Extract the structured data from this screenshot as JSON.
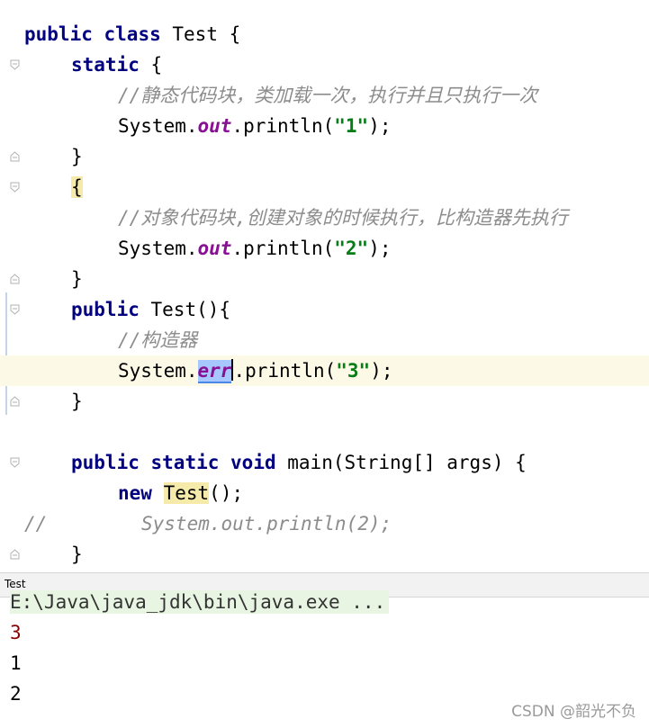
{
  "editor": {
    "lines": {
      "l1": {
        "kw1": "public",
        "kw2": "class",
        "name": "Test",
        "brace": "{"
      },
      "l2": {
        "kw": "static",
        "brace": "{"
      },
      "l3": {
        "comment": "//静态代码块，类加载一次，执行并且只执行一次"
      },
      "l4": {
        "pre": "System.",
        "field": "out",
        "mid": ".println(",
        "str": "\"1\"",
        "post": ");"
      },
      "l5": {
        "brace": "}"
      },
      "l6": {
        "brace": "{"
      },
      "l7": {
        "comment": "//对象代码块,创建对象的时候执行，比构造器先执行"
      },
      "l8": {
        "pre": "System.",
        "field": "out",
        "mid": ".println(",
        "str": "\"2\"",
        "post": ");"
      },
      "l9": {
        "brace": "}"
      },
      "l10": {
        "kw": "public",
        "rest": "Test(){"
      },
      "l11": {
        "comment": "//构造器"
      },
      "l12": {
        "pre": "System.",
        "field": "err",
        "mid": ".println(",
        "str": "\"3\"",
        "post": ");"
      },
      "l13": {
        "brace": "}"
      },
      "l15": {
        "kw1": "public",
        "kw2": "static",
        "kw3": "void",
        "rest": "main(String[] args) {"
      },
      "l16": {
        "kw": "new",
        "name": "Test",
        "rest": "();"
      },
      "l17": {
        "prefix": "//",
        "comment": "System.out.println(2);"
      },
      "l18": {
        "brace": "}"
      }
    }
  },
  "tool_window": {
    "tab_label": "Test"
  },
  "console": {
    "command": "E:\\Java\\java_jdk\\bin\\java.exe ...",
    "outputs": [
      "3",
      "1",
      "2"
    ],
    "colors": {
      "stderr": "#8b0000",
      "stdout": "#000000"
    }
  },
  "watermark": "CSDN @韶光不负",
  "colors": {
    "keyword": "#000080",
    "string": "#067d17",
    "field": "#871094",
    "comment": "#8c8c8c",
    "current_line": "#fcfae6"
  },
  "icons": [
    "fold-open-icon",
    "fold-close-icon"
  ]
}
